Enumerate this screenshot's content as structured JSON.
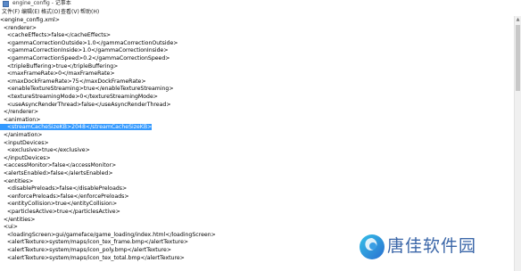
{
  "window": {
    "title": "engine_config - 记事本"
  },
  "menu": {
    "items": [
      "文件(F)",
      "编辑(E)",
      "格式(O)",
      "查看(V)",
      "帮助(H)"
    ]
  },
  "editor": {
    "lines": [
      "<engine_config.xml>",
      "  <renderer>",
      "    <cacheEffects>false</cacheEffects>",
      "    <gammaCorrectionOutside>1.0</gammaCorrectionOutside>",
      "    <gammaCorrectionInside>1.0</gammaCorrectionInside>",
      "    <gammaCorrectionSpeed>0.2</gammaCorrectionSpeed>",
      "    <tripleBuffering>true</tripleBuffering>",
      "    <maxFrameRate>0</maxFrameRate>",
      "    <maxDockFrameRate>75</maxDockFrameRate>",
      "    <enableTextureStreaming>true</enableTextureStreaming>",
      "    <textureStreamingMode>0</textureStreamingMode>",
      "    <useAsyncRenderThread>false</useAsyncRenderThread>",
      "  </renderer>",
      "  <animation>",
      "    <streamCacheSizeKB>2048</streamCacheSizeKB>",
      "  </animation>",
      "  <inputDevices>",
      "    <exclusive>true</exclusive>",
      "  </inputDevices>",
      "  <accessMonitor>false</accessMonitor>",
      "  <alertsEnabled>false</alertsEnabled>",
      "  <entities>",
      "    <disablePreloads>false</disablePreloads>",
      "    <enforcePreloads>false</enforcePreloads>",
      "    <entityCollision>true</entityCollision>",
      "    <particlesActive>true</particlesActive>",
      "  </entities>",
      "  <ui>",
      "    <loadingScreen>gui/gameface/game_loading/index.html</loadingScreen>",
      "    <alertTexture>system/maps/icon_tex_frame.bmp</alertTexture>",
      "    <alertTexture>system/maps/icon_poly.bmp</alertTexture>",
      "    <alertTexture>system/maps/icon_tex_total.bmp</alertTexture>"
    ],
    "selected_line_index": 14
  },
  "watermark": {
    "text": "唐佳软件园",
    "brand_color": "#3a66a8"
  }
}
